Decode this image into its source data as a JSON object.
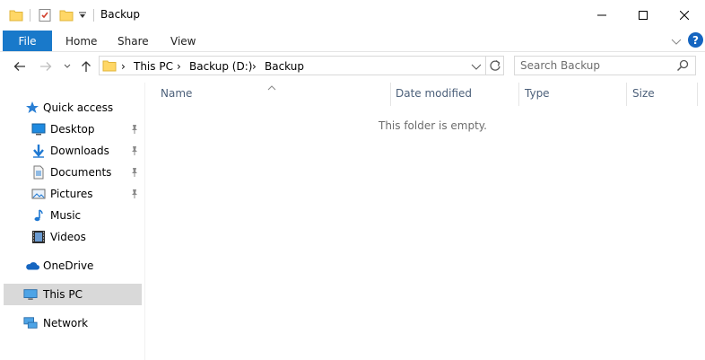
{
  "window": {
    "title": "Backup"
  },
  "ribbon": {
    "file": "File",
    "home": "Home",
    "share": "Share",
    "view": "View"
  },
  "address": {
    "crumbs": [
      "This PC",
      "Backup (D:)",
      "Backup"
    ]
  },
  "search": {
    "placeholder": "Search Backup"
  },
  "sidebar": {
    "quick_access": "Quick access",
    "items": [
      "Desktop",
      "Downloads",
      "Documents",
      "Pictures",
      "Music",
      "Videos"
    ],
    "onedrive": "OneDrive",
    "thispc": "This PC",
    "network": "Network"
  },
  "columns": {
    "name": "Name",
    "date": "Date modified",
    "type": "Type",
    "size": "Size"
  },
  "content": {
    "empty": "This folder is empty."
  },
  "colors": {
    "accent": "#1979ca",
    "selected": "#d9d9d9"
  }
}
